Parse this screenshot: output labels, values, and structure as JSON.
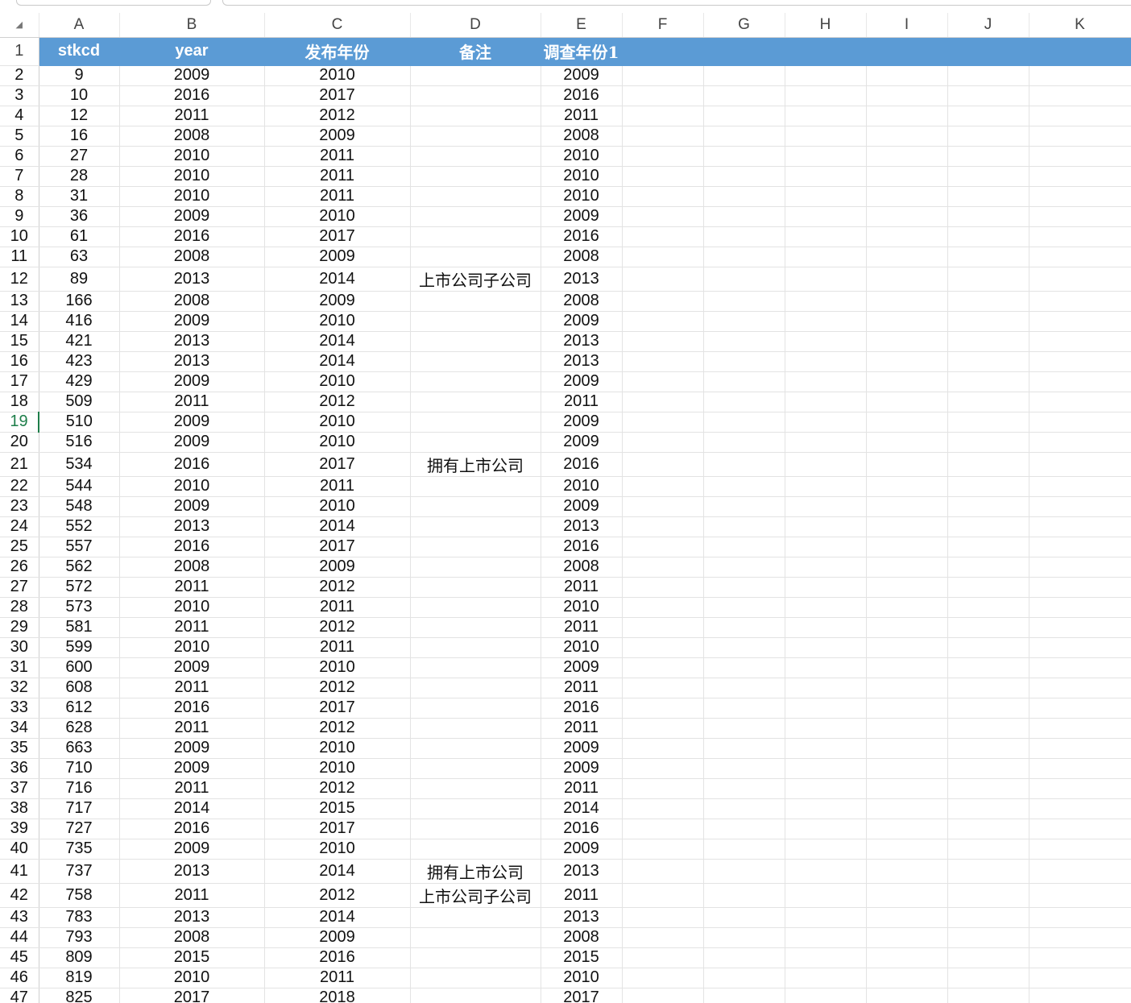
{
  "columns": [
    "A",
    "B",
    "C",
    "D",
    "E",
    "F",
    "G",
    "H",
    "I",
    "J",
    "K"
  ],
  "corner_icon": "select-all-triangle",
  "header_row": {
    "row_number": "1",
    "cells": [
      "stkcd",
      "year",
      "发布年份",
      "备注",
      "调查年份1",
      "",
      "",
      "",
      "",
      "",
      ""
    ]
  },
  "active_row": "19",
  "rows": [
    {
      "n": "2",
      "a": "9",
      "b": "2009",
      "c": "2010",
      "d": "",
      "e": "2009"
    },
    {
      "n": "3",
      "a": "10",
      "b": "2016",
      "c": "2017",
      "d": "",
      "e": "2016"
    },
    {
      "n": "4",
      "a": "12",
      "b": "2011",
      "c": "2012",
      "d": "",
      "e": "2011"
    },
    {
      "n": "5",
      "a": "16",
      "b": "2008",
      "c": "2009",
      "d": "",
      "e": "2008"
    },
    {
      "n": "6",
      "a": "27",
      "b": "2010",
      "c": "2011",
      "d": "",
      "e": "2010"
    },
    {
      "n": "7",
      "a": "28",
      "b": "2010",
      "c": "2011",
      "d": "",
      "e": "2010"
    },
    {
      "n": "8",
      "a": "31",
      "b": "2010",
      "c": "2011",
      "d": "",
      "e": "2010"
    },
    {
      "n": "9",
      "a": "36",
      "b": "2009",
      "c": "2010",
      "d": "",
      "e": "2009"
    },
    {
      "n": "10",
      "a": "61",
      "b": "2016",
      "c": "2017",
      "d": "",
      "e": "2016"
    },
    {
      "n": "11",
      "a": "63",
      "b": "2008",
      "c": "2009",
      "d": "",
      "e": "2008"
    },
    {
      "n": "12",
      "a": "89",
      "b": "2013",
      "c": "2014",
      "d": "上市公司子公司",
      "e": "2013"
    },
    {
      "n": "13",
      "a": "166",
      "b": "2008",
      "c": "2009",
      "d": "",
      "e": "2008"
    },
    {
      "n": "14",
      "a": "416",
      "b": "2009",
      "c": "2010",
      "d": "",
      "e": "2009"
    },
    {
      "n": "15",
      "a": "421",
      "b": "2013",
      "c": "2014",
      "d": "",
      "e": "2013"
    },
    {
      "n": "16",
      "a": "423",
      "b": "2013",
      "c": "2014",
      "d": "",
      "e": "2013"
    },
    {
      "n": "17",
      "a": "429",
      "b": "2009",
      "c": "2010",
      "d": "",
      "e": "2009"
    },
    {
      "n": "18",
      "a": "509",
      "b": "2011",
      "c": "2012",
      "d": "",
      "e": "2011"
    },
    {
      "n": "19",
      "a": "510",
      "b": "2009",
      "c": "2010",
      "d": "",
      "e": "2009"
    },
    {
      "n": "20",
      "a": "516",
      "b": "2009",
      "c": "2010",
      "d": "",
      "e": "2009"
    },
    {
      "n": "21",
      "a": "534",
      "b": "2016",
      "c": "2017",
      "d": "拥有上市公司",
      "e": "2016"
    },
    {
      "n": "22",
      "a": "544",
      "b": "2010",
      "c": "2011",
      "d": "",
      "e": "2010"
    },
    {
      "n": "23",
      "a": "548",
      "b": "2009",
      "c": "2010",
      "d": "",
      "e": "2009"
    },
    {
      "n": "24",
      "a": "552",
      "b": "2013",
      "c": "2014",
      "d": "",
      "e": "2013"
    },
    {
      "n": "25",
      "a": "557",
      "b": "2016",
      "c": "2017",
      "d": "",
      "e": "2016"
    },
    {
      "n": "26",
      "a": "562",
      "b": "2008",
      "c": "2009",
      "d": "",
      "e": "2008"
    },
    {
      "n": "27",
      "a": "572",
      "b": "2011",
      "c": "2012",
      "d": "",
      "e": "2011"
    },
    {
      "n": "28",
      "a": "573",
      "b": "2010",
      "c": "2011",
      "d": "",
      "e": "2010"
    },
    {
      "n": "29",
      "a": "581",
      "b": "2011",
      "c": "2012",
      "d": "",
      "e": "2011"
    },
    {
      "n": "30",
      "a": "599",
      "b": "2010",
      "c": "2011",
      "d": "",
      "e": "2010"
    },
    {
      "n": "31",
      "a": "600",
      "b": "2009",
      "c": "2010",
      "d": "",
      "e": "2009"
    },
    {
      "n": "32",
      "a": "608",
      "b": "2011",
      "c": "2012",
      "d": "",
      "e": "2011"
    },
    {
      "n": "33",
      "a": "612",
      "b": "2016",
      "c": "2017",
      "d": "",
      "e": "2016"
    },
    {
      "n": "34",
      "a": "628",
      "b": "2011",
      "c": "2012",
      "d": "",
      "e": "2011"
    },
    {
      "n": "35",
      "a": "663",
      "b": "2009",
      "c": "2010",
      "d": "",
      "e": "2009"
    },
    {
      "n": "36",
      "a": "710",
      "b": "2009",
      "c": "2010",
      "d": "",
      "e": "2009"
    },
    {
      "n": "37",
      "a": "716",
      "b": "2011",
      "c": "2012",
      "d": "",
      "e": "2011"
    },
    {
      "n": "38",
      "a": "717",
      "b": "2014",
      "c": "2015",
      "d": "",
      "e": "2014"
    },
    {
      "n": "39",
      "a": "727",
      "b": "2016",
      "c": "2017",
      "d": "",
      "e": "2016"
    },
    {
      "n": "40",
      "a": "735",
      "b": "2009",
      "c": "2010",
      "d": "",
      "e": "2009"
    },
    {
      "n": "41",
      "a": "737",
      "b": "2013",
      "c": "2014",
      "d": "拥有上市公司",
      "e": "2013"
    },
    {
      "n": "42",
      "a": "758",
      "b": "2011",
      "c": "2012",
      "d": "上市公司子公司",
      "e": "2011"
    },
    {
      "n": "43",
      "a": "783",
      "b": "2013",
      "c": "2014",
      "d": "",
      "e": "2013"
    },
    {
      "n": "44",
      "a": "793",
      "b": "2008",
      "c": "2009",
      "d": "",
      "e": "2008"
    },
    {
      "n": "45",
      "a": "809",
      "b": "2015",
      "c": "2016",
      "d": "",
      "e": "2015"
    },
    {
      "n": "46",
      "a": "819",
      "b": "2010",
      "c": "2011",
      "d": "",
      "e": "2010"
    },
    {
      "n": "47",
      "a": "825",
      "b": "2017",
      "c": "2018",
      "d": "",
      "e": "2017"
    }
  ],
  "colors": {
    "header_fill": "#5b9bd5",
    "header_text": "#ffffff",
    "active_row_indicator": "#1e7e4a",
    "gridline": "#e3e3e3"
  }
}
